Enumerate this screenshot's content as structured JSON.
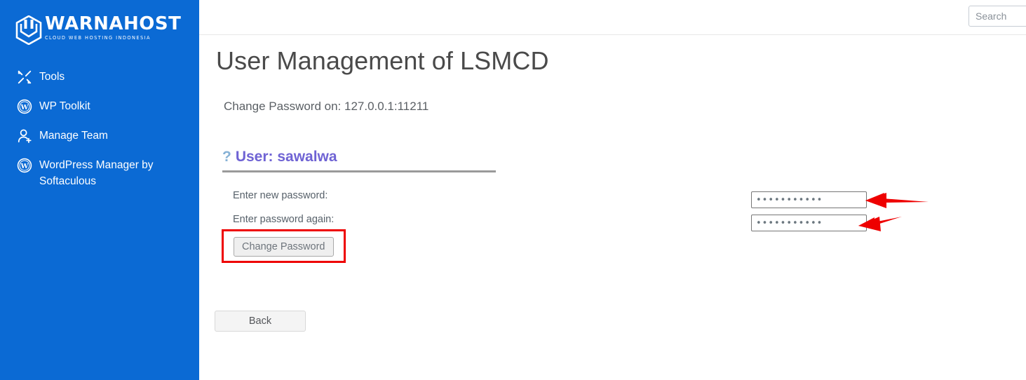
{
  "sidebar": {
    "background_color": "#0B6AD4",
    "logo": {
      "name": "WARNAHOST",
      "tagline": "CLOUD WEB HOSTING INDONESIA",
      "icon": "warnahost-hexagon-logo-icon"
    },
    "items": [
      {
        "label": "Tools",
        "icon": "tools-wrench-screwdriver-icon"
      },
      {
        "label": "WP Toolkit",
        "icon": "wordpress-icon"
      },
      {
        "label": "Manage Team",
        "icon": "user-add-icon"
      },
      {
        "label": "WordPress Manager by Softaculous",
        "icon": "wordpress-icon"
      }
    ]
  },
  "header": {
    "search": {
      "placeholder": "Search",
      "value": ""
    }
  },
  "main": {
    "page_title": "User Management of LSMCD",
    "subtitle": "Change Password on: 127.0.0.1:11211",
    "user_section": {
      "help_icon": "?",
      "heading": "User: sawalwa",
      "heading_color": "#6f63d4",
      "help_icon_color": "#87b2d6"
    },
    "form": {
      "new_password_label": "Enter new password:",
      "again_password_label": "Enter password again:",
      "new_password_value": "•••••••••••",
      "again_password_value": "•••••••••••",
      "new_password_placeholder": "",
      "again_password_placeholder": "",
      "submit_label": "Change Password"
    },
    "back_label": "Back",
    "annotations": {
      "highlight_color": "#ee0000",
      "arrow_color": "#ee0000",
      "arrow_count": 2
    }
  }
}
